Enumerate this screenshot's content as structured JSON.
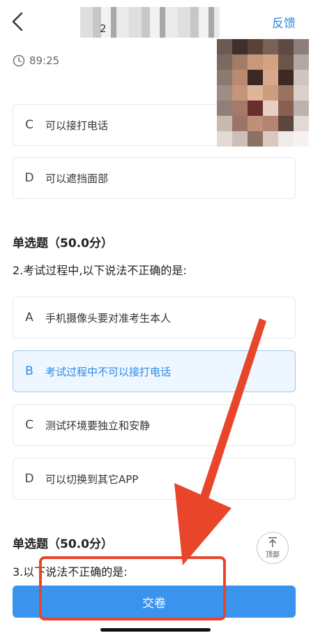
{
  "header": {
    "title_fragment": "2",
    "feedback_label": "反馈"
  },
  "timer": {
    "value": "89:25"
  },
  "question1_options": [
    {
      "letter": "C",
      "text": "可以接打电话"
    },
    {
      "letter": "D",
      "text": "可以遮挡面部"
    }
  ],
  "question2": {
    "type_label": "单选题（50.0分）",
    "text": "2.考试过程中,以下说法不正确的是:",
    "selected": "B",
    "options": [
      {
        "letter": "A",
        "text": "手机摄像头要对准考生本人"
      },
      {
        "letter": "B",
        "text": "考试过程中不可以接打电话"
      },
      {
        "letter": "C",
        "text": "测试环境要独立和安静"
      },
      {
        "letter": "D",
        "text": "可以切换到其它APP"
      }
    ]
  },
  "question3": {
    "type_label": "单选题（50.0分）",
    "text": "3.以下说法不正确的是:"
  },
  "top_button": {
    "label": "顶部"
  },
  "submit": {
    "label": "交卷"
  },
  "colors": {
    "accent": "#3a93ec",
    "link": "#2f8ae6",
    "selected_bg": "#eef6ff",
    "annotation_red": "#e8452a"
  }
}
